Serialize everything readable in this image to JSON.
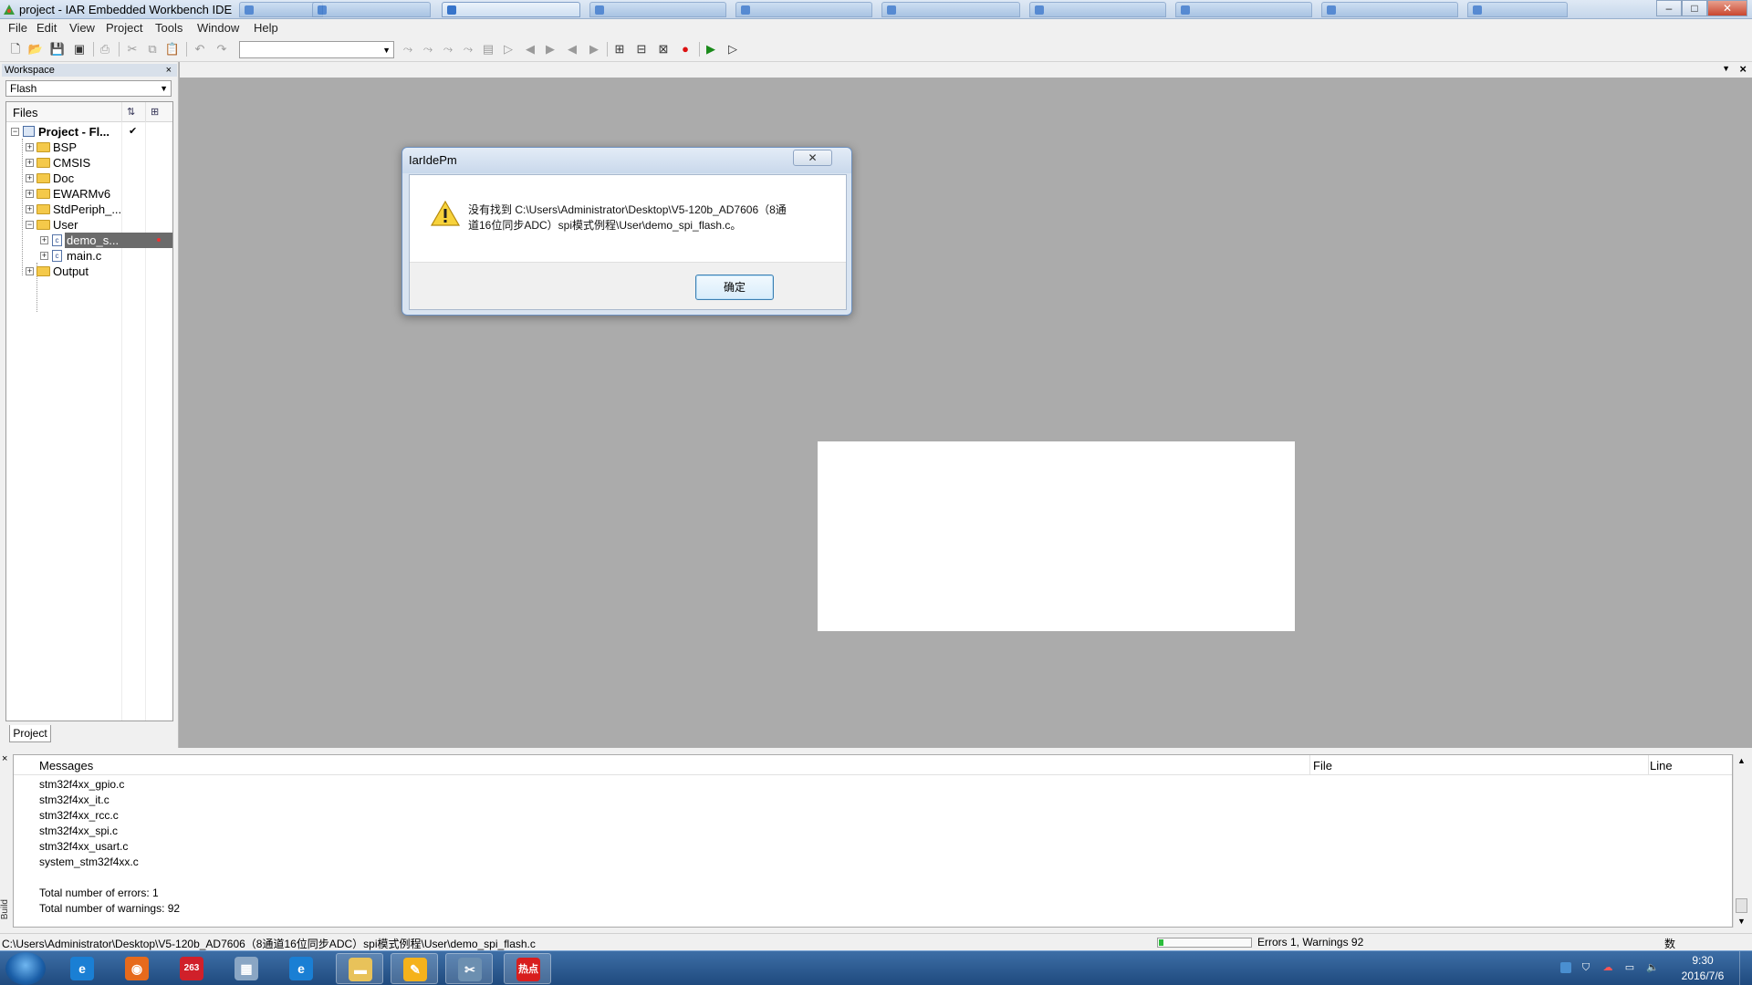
{
  "window": {
    "title": "project - IAR Embedded Workbench IDE",
    "controls": {
      "minimize": "–",
      "maximize": "□",
      "close": "✕"
    }
  },
  "menu": [
    "File",
    "Edit",
    "View",
    "Project",
    "Tools",
    "Window",
    "Help"
  ],
  "toolbar": {
    "config_combo_value": ""
  },
  "workspace": {
    "title": "Workspace",
    "close": "×",
    "config": "Flash",
    "files_header": "Files",
    "check_mark": "✔",
    "tree": [
      {
        "label": "Project - Fl...",
        "type": "project",
        "expander": "−"
      },
      {
        "label": "BSP",
        "type": "folder",
        "expander": "+"
      },
      {
        "label": "CMSIS",
        "type": "folder",
        "expander": "+"
      },
      {
        "label": "Doc",
        "type": "folder",
        "expander": "+"
      },
      {
        "label": "EWARMv6",
        "type": "folder",
        "expander": "+"
      },
      {
        "label": "StdPeriph_...",
        "type": "folder",
        "expander": "+"
      },
      {
        "label": "User",
        "type": "folder",
        "expander": "−"
      },
      {
        "label": "demo_s...",
        "type": "file",
        "expander": "+"
      },
      {
        "label": "main.c",
        "type": "file",
        "expander": "+"
      },
      {
        "label": "Output",
        "type": "folder",
        "expander": "+"
      }
    ],
    "bottom_tab": "Project"
  },
  "dialog": {
    "title": "IarIdePm",
    "close": "✕",
    "message_line1": "没有找到 C:\\Users\\Administrator\\Desktop\\V5-120b_AD7606（8通",
    "message_line2": "道16位同步ADC）spi模式例程\\User\\demo_spi_flash.c。",
    "ok": "确定"
  },
  "messages": {
    "close": "×",
    "columns": [
      "Messages",
      "File",
      "Line"
    ],
    "lines": [
      "stm32f4xx_gpio.c",
      "stm32f4xx_it.c",
      "stm32f4xx_rcc.c",
      "stm32f4xx_spi.c",
      "stm32f4xx_usart.c",
      "system_stm32f4xx.c",
      "",
      "Total number of errors: 1",
      "Total number of warnings: 92"
    ],
    "side_tab": "Build"
  },
  "status": {
    "path": "C:\\Users\\Administrator\\Desktop\\V5-120b_AD7606（8通道16位同步ADC）spi模式例程\\User\\demo_spi_flash.c",
    "progress": 0.05,
    "errors": "Errors 1, Warnings 92",
    "extra": "数"
  },
  "taskbar": {
    "time": "9:30",
    "date": "2016/7/6",
    "apps": [
      {
        "name": "ie",
        "color": "#1a7fd4",
        "glyph": "e"
      },
      {
        "name": "firefox",
        "color": "#e66a1c",
        "glyph": "◉"
      },
      {
        "name": "263",
        "color": "#d0202a",
        "glyph": "263"
      },
      {
        "name": "calculator",
        "color": "#8aa6c4",
        "glyph": "▦"
      },
      {
        "name": "ie2",
        "color": "#1a7fd4",
        "glyph": "e"
      },
      {
        "name": "explorer",
        "color": "#e8c25a",
        "glyph": "▬"
      },
      {
        "name": "iar",
        "color": "#f5b21b",
        "glyph": "✎"
      },
      {
        "name": "tools",
        "color": "#6c8fb0",
        "glyph": "✂"
      },
      {
        "name": "hot",
        "color": "#d81e1e",
        "glyph": "热点"
      }
    ]
  },
  "colors": {
    "accent": "#1f4a7e",
    "dialog_border": "#6b8fbf",
    "progress": "#2bbd3c"
  }
}
